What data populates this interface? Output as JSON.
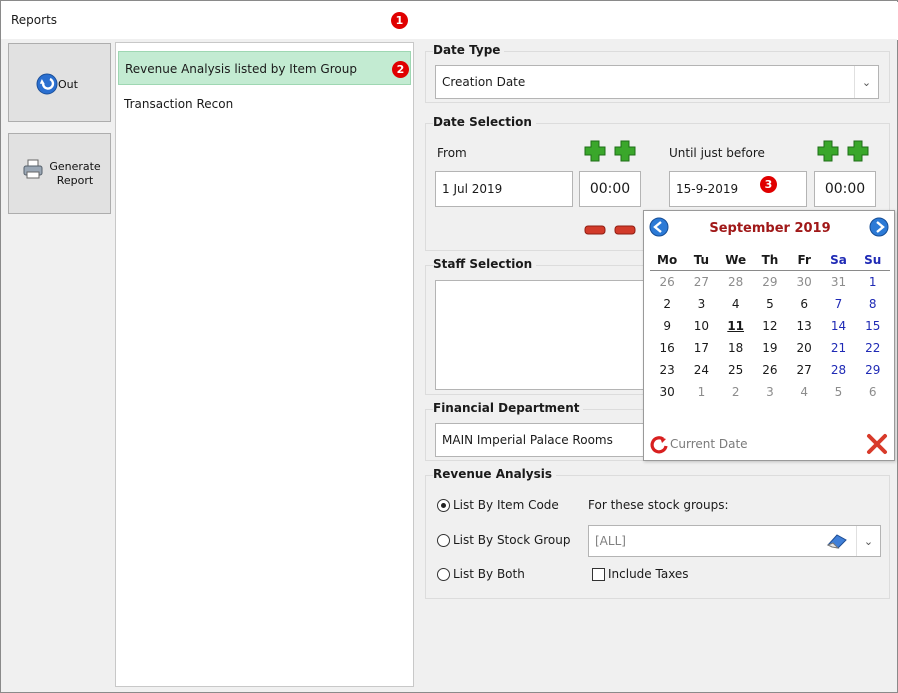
{
  "window": {
    "title": "Reports"
  },
  "markers": [
    "1",
    "2",
    "3"
  ],
  "sidebar": {
    "out_label": "Out",
    "generate_label_line1": "Generate",
    "generate_label_line2": "Report"
  },
  "reports": [
    "Revenue Analysis listed by Item Group",
    "Transaction Recon"
  ],
  "date_type": {
    "title": "Date Type",
    "value": "Creation Date"
  },
  "date_selection": {
    "title": "Date Selection",
    "from_label": "From",
    "from_date": "1 Jul 2019",
    "from_time": "00:00",
    "until_label": "Until just before",
    "until_date": "15-9-2019",
    "until_time": "00:00"
  },
  "staff_selection": {
    "title": "Staff Selection"
  },
  "financial_department": {
    "title": "Financial Department",
    "value": "MAIN Imperial Palace Rooms"
  },
  "calendar": {
    "month_title": "September 2019",
    "weekdays": [
      "Mo",
      "Tu",
      "We",
      "Th",
      "Fr",
      "Sa",
      "Su"
    ],
    "weeks": [
      [
        "26",
        "27",
        "28",
        "29",
        "30",
        "31",
        "1"
      ],
      [
        "2",
        "3",
        "4",
        "5",
        "6",
        "7",
        "8"
      ],
      [
        "9",
        "10",
        "11",
        "12",
        "13",
        "14",
        "15"
      ],
      [
        "16",
        "17",
        "18",
        "19",
        "20",
        "21",
        "22"
      ],
      [
        "23",
        "24",
        "25",
        "26",
        "27",
        "28",
        "29"
      ],
      [
        "30",
        "1",
        "2",
        "3",
        "4",
        "5",
        "6"
      ]
    ],
    "today": "11",
    "current_date_label": "Current Date"
  },
  "revenue_analysis": {
    "title": "Revenue Analysis",
    "option_item_code": "List By Item Code",
    "option_stock_group": "List By Stock Group",
    "option_both": "List By Both",
    "selected_option": "List By Item Code",
    "stock_groups_label": "For these stock groups:",
    "stock_groups_value": "[ALL]",
    "include_taxes_label": "Include Taxes",
    "include_taxes_checked": false
  },
  "colors": {
    "selected_row": "#c3ebd2",
    "marker_red": "#e00000",
    "calendar_title": "#a01818",
    "weekend_blue": "#1f2ab5",
    "plus_green": "#3aa72b",
    "minus_red": "#d23a2a"
  }
}
